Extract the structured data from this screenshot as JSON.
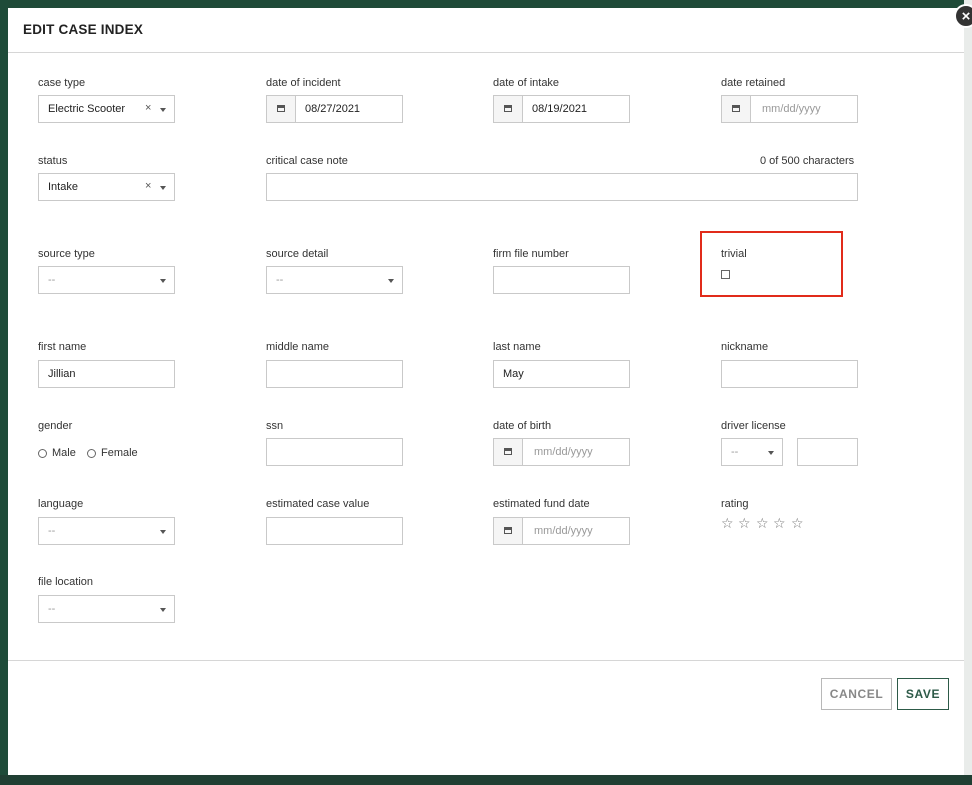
{
  "modal": {
    "title": "EDIT CASE INDEX",
    "close_symbol": "×"
  },
  "fields": {
    "case_type": {
      "label": "case type",
      "value": "Electric Scooter",
      "clear": "×"
    },
    "date_of_incident": {
      "label": "date of incident",
      "value": "08/27/2021"
    },
    "date_of_intake": {
      "label": "date of intake",
      "value": "08/19/2021"
    },
    "date_retained": {
      "label": "date retained",
      "placeholder": "mm/dd/yyyy"
    },
    "status": {
      "label": "status",
      "value": "Intake",
      "clear": "×"
    },
    "critical_case_note": {
      "label": "critical case note",
      "counter": "0 of 500 characters",
      "value": ""
    },
    "source_type": {
      "label": "source type",
      "placeholder": "--"
    },
    "source_detail": {
      "label": "source detail",
      "placeholder": "--"
    },
    "firm_file_number": {
      "label": "firm file number",
      "value": ""
    },
    "trivial": {
      "label": "trivial",
      "checked": false
    },
    "first_name": {
      "label": "first name",
      "value": "Jillian"
    },
    "middle_name": {
      "label": "middle name",
      "value": ""
    },
    "last_name": {
      "label": "last name",
      "value": "May"
    },
    "nickname": {
      "label": "nickname",
      "value": ""
    },
    "gender": {
      "label": "gender",
      "options": [
        "Male",
        "Female"
      ]
    },
    "ssn": {
      "label": "ssn",
      "value": ""
    },
    "date_of_birth": {
      "label": "date of birth",
      "placeholder": "mm/dd/yyyy"
    },
    "driver_license": {
      "label": "driver license",
      "placeholder": "--",
      "number": ""
    },
    "language": {
      "label": "language",
      "placeholder": "--"
    },
    "estimated_case_value": {
      "label": "estimated case value",
      "value": ""
    },
    "estimated_fund_date": {
      "label": "estimated fund date",
      "placeholder": "mm/dd/yyyy"
    },
    "rating": {
      "label": "rating",
      "stars": 5,
      "filled": 0,
      "star_glyph": "☆"
    },
    "file_location": {
      "label": "file location",
      "placeholder": "--"
    }
  },
  "footer": {
    "cancel_label": "CANCEL",
    "save_label": "SAVE"
  },
  "colors": {
    "accent": "#2d5a48",
    "highlight": "#e12b1a"
  }
}
